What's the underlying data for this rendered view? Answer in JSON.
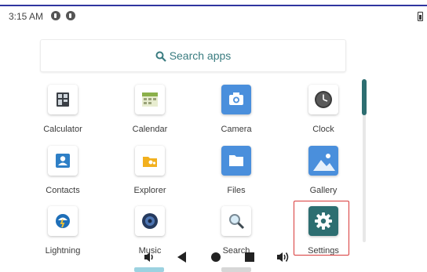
{
  "status": {
    "time": "3:15 AM"
  },
  "search": {
    "label": "Search apps"
  },
  "apps": [
    {
      "label": "Calculator"
    },
    {
      "label": "Calendar"
    },
    {
      "label": "Camera"
    },
    {
      "label": "Clock"
    },
    {
      "label": "Contacts"
    },
    {
      "label": "Explorer"
    },
    {
      "label": "Files"
    },
    {
      "label": "Gallery"
    },
    {
      "label": "Lightning"
    },
    {
      "label": "Music"
    },
    {
      "label": "Search"
    },
    {
      "label": "Settings"
    }
  ],
  "icons": {
    "calculator": "calculator-icon",
    "calendar": "calendar-icon",
    "camera": "camera-icon",
    "clock": "clock-icon",
    "contacts": "contacts-icon",
    "explorer": "explorer-icon",
    "files": "folder-icon",
    "gallery": "gallery-icon",
    "lightning": "lightning-icon",
    "music": "music-icon",
    "search": "magnifier-icon",
    "settings": "gear-icon"
  },
  "colors": {
    "accent": "#2d6e71",
    "highlight": "#d83a3a",
    "files_blue": "#4a8fdc"
  }
}
